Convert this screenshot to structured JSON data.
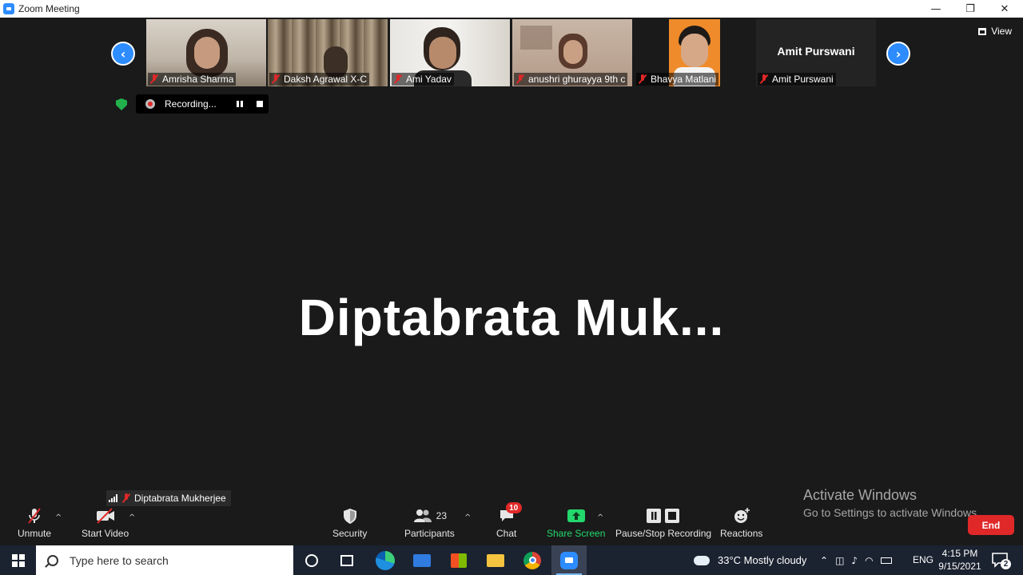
{
  "window": {
    "title": "Zoom Meeting",
    "minimize": "—",
    "restore": "❐",
    "close": "✕"
  },
  "gallery": {
    "prev_glyph": "‹",
    "next_glyph": "›",
    "participants": [
      {
        "name": "Amrisha Sharma"
      },
      {
        "name": "Daksh Agrawal X-C"
      },
      {
        "name": "Ami Yadav"
      },
      {
        "name": "anushri ghurayya 9th c"
      },
      {
        "name": "Bhavya Matlani"
      },
      {
        "name": "Amit Purswani",
        "display_name": "Amit Purswani"
      }
    ]
  },
  "view": {
    "label": "View"
  },
  "recording": {
    "label": "Recording..."
  },
  "speaker": {
    "display": "Diptabrata  Muk...",
    "tag": "Diptabrata Mukherjee"
  },
  "watermark": {
    "line1": "Activate Windows",
    "line2": "Go to Settings to activate Windows."
  },
  "toolbar": {
    "unmute": "Unmute",
    "start_video": "Start Video",
    "security": "Security",
    "participants": "Participants",
    "participants_count": "23",
    "chat": "Chat",
    "chat_badge": "10",
    "share_screen": "Share Screen",
    "recording": "Pause/Stop Recording",
    "reactions": "Reactions",
    "end": "End",
    "share_color": "#23d96c",
    "end_color": "#e02828"
  },
  "taskbar": {
    "search_placeholder": "Type here to search",
    "weather": "33°C  Mostly cloudy",
    "language": "ENG",
    "time": "4:15 PM",
    "date": "9/15/2021",
    "notification_count": "2"
  }
}
